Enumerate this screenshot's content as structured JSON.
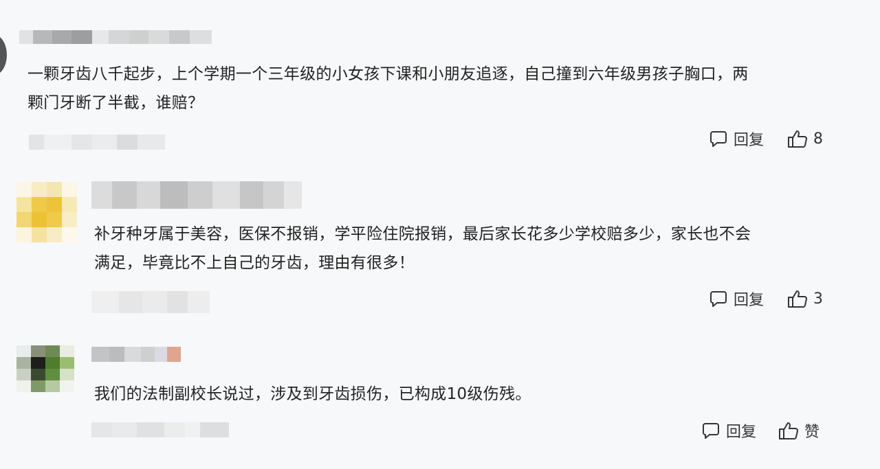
{
  "comments": [
    {
      "text_line1": "一颗牙齿八千起步，上个学期一个三年级的小女孩下课和小朋友追逐，自己撞到六年级男孩子胸口，两",
      "text_line2": "颗门牙断了半截，谁赔？",
      "reply_label": "回复",
      "like_count": "8"
    },
    {
      "text_line1": "补牙种牙属于美容，医保不报销，学平险住院报销，最后家长花多少学校赔多少，家长也不会",
      "text_line2": "满足，毕竟比不上自己的牙齿，理由有很多！",
      "reply_label": "回复",
      "like_count": "3"
    },
    {
      "text_line1": "我们的法制副校长说过，涉及到牙齿损伤，已构成10级伤残。",
      "reply_label": "回复",
      "like_label": "赞"
    }
  ],
  "icons": {
    "reply": "comment-bubble-icon",
    "like": "thumbs-up-icon"
  },
  "colors": {
    "background": "#f7f8fa",
    "text": "#222222",
    "icon": "#333333"
  }
}
